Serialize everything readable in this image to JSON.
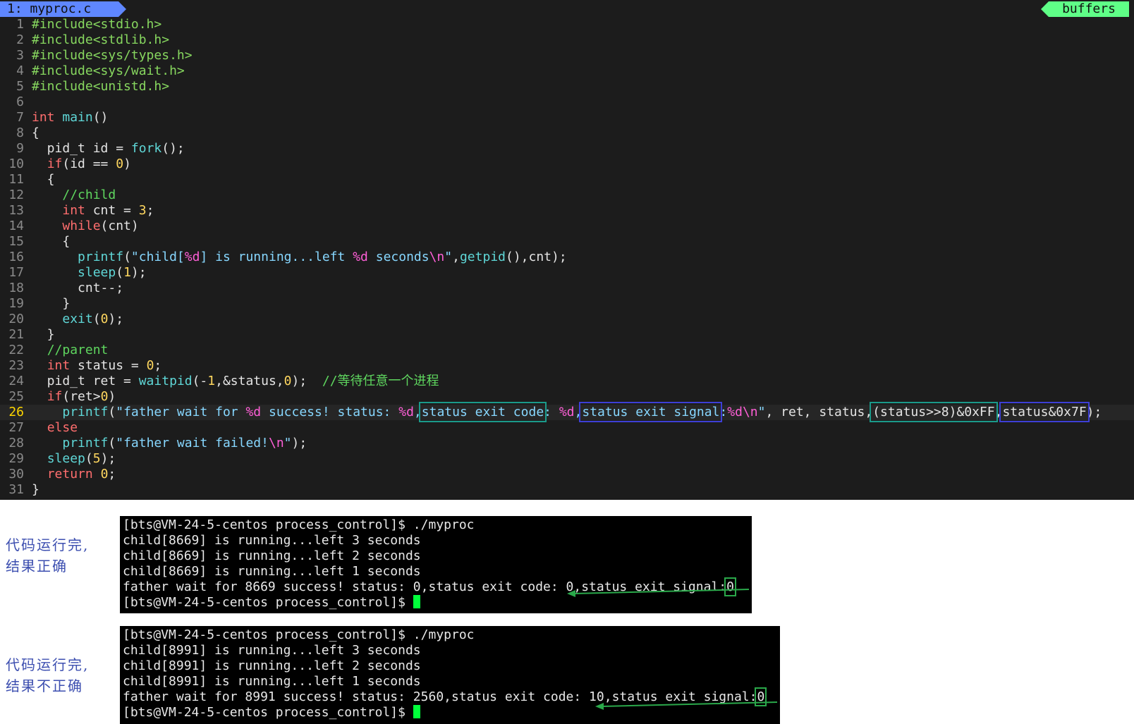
{
  "tabline": {
    "active_tab": "1: myproc.c",
    "buffers_label": "buffers"
  },
  "editor": {
    "current_line": 26,
    "lines": [
      {
        "n": "1",
        "t": [
          [
            "pp",
            "#include<stdio.h>"
          ]
        ]
      },
      {
        "n": "2",
        "t": [
          [
            "pp",
            "#include<stdlib.h>"
          ]
        ]
      },
      {
        "n": "3",
        "t": [
          [
            "pp",
            "#include<sys/types.h>"
          ]
        ]
      },
      {
        "n": "4",
        "t": [
          [
            "pp",
            "#include<sys/wait.h>"
          ]
        ]
      },
      {
        "n": "5",
        "t": [
          [
            "pp",
            "#include<unistd.h>"
          ]
        ]
      },
      {
        "n": "6",
        "t": []
      },
      {
        "n": "7",
        "t": [
          [
            "kw",
            "int"
          ],
          [
            "op",
            " "
          ],
          [
            "fn",
            "main"
          ],
          [
            "op",
            "()"
          ]
        ]
      },
      {
        "n": "8",
        "t": [
          [
            "op",
            "{"
          ]
        ]
      },
      {
        "n": "9",
        "t": [
          [
            "op",
            "  pid_t id = "
          ],
          [
            "fn",
            "fork"
          ],
          [
            "op",
            "();"
          ]
        ]
      },
      {
        "n": "10",
        "t": [
          [
            "op",
            "  "
          ],
          [
            "kw",
            "if"
          ],
          [
            "op",
            "(id == "
          ],
          [
            "num",
            "0"
          ],
          [
            "op",
            ")"
          ]
        ]
      },
      {
        "n": "11",
        "t": [
          [
            "op",
            "  {"
          ]
        ]
      },
      {
        "n": "12",
        "t": [
          [
            "op",
            "    "
          ],
          [
            "cm",
            "//child"
          ]
        ]
      },
      {
        "n": "13",
        "t": [
          [
            "op",
            "    "
          ],
          [
            "kw",
            "int"
          ],
          [
            "op",
            " cnt = "
          ],
          [
            "num",
            "3"
          ],
          [
            "op",
            ";"
          ]
        ]
      },
      {
        "n": "14",
        "t": [
          [
            "op",
            "    "
          ],
          [
            "kw",
            "while"
          ],
          [
            "op",
            "(cnt)"
          ]
        ]
      },
      {
        "n": "15",
        "t": [
          [
            "op",
            "    {"
          ]
        ]
      },
      {
        "n": "16",
        "t": [
          [
            "op",
            "      "
          ],
          [
            "fn",
            "printf"
          ],
          [
            "op",
            "("
          ],
          [
            "st",
            "\"child["
          ],
          [
            "fmt",
            "%d"
          ],
          [
            "st",
            "] is running...left "
          ],
          [
            "fmt",
            "%d"
          ],
          [
            "st",
            " seconds"
          ],
          [
            "fmt",
            "\\n"
          ],
          [
            "st",
            "\""
          ],
          [
            "op",
            ","
          ],
          [
            "fn",
            "getpid"
          ],
          [
            "op",
            "(),cnt);"
          ]
        ]
      },
      {
        "n": "17",
        "t": [
          [
            "op",
            "      "
          ],
          [
            "fn",
            "sleep"
          ],
          [
            "op",
            "("
          ],
          [
            "num",
            "1"
          ],
          [
            "op",
            ");"
          ]
        ]
      },
      {
        "n": "18",
        "t": [
          [
            "op",
            "      cnt--;"
          ]
        ]
      },
      {
        "n": "19",
        "t": [
          [
            "op",
            "    }"
          ]
        ]
      },
      {
        "n": "20",
        "t": [
          [
            "op",
            "    "
          ],
          [
            "fn",
            "exit"
          ],
          [
            "op",
            "("
          ],
          [
            "num",
            "0"
          ],
          [
            "op",
            ");"
          ]
        ]
      },
      {
        "n": "21",
        "t": [
          [
            "op",
            "  }"
          ]
        ]
      },
      {
        "n": "22",
        "t": [
          [
            "op",
            "  "
          ],
          [
            "cm",
            "//parent"
          ]
        ]
      },
      {
        "n": "23",
        "t": [
          [
            "op",
            "  "
          ],
          [
            "kw",
            "int"
          ],
          [
            "op",
            " status = "
          ],
          [
            "num",
            "0"
          ],
          [
            "op",
            ";"
          ]
        ]
      },
      {
        "n": "24",
        "t": [
          [
            "op",
            "  pid_t ret = "
          ],
          [
            "fn",
            "waitpid"
          ],
          [
            "op",
            "(-"
          ],
          [
            "num",
            "1"
          ],
          [
            "op",
            ",&status,"
          ],
          [
            "num",
            "0"
          ],
          [
            "op",
            ");  "
          ],
          [
            "cm",
            "//等待任意一个进程"
          ]
        ]
      },
      {
        "n": "25",
        "t": [
          [
            "op",
            "  "
          ],
          [
            "kw",
            "if"
          ],
          [
            "op",
            "(ret>"
          ],
          [
            "num",
            "0"
          ],
          [
            "op",
            ")"
          ]
        ]
      },
      {
        "n": "26",
        "t": [
          [
            "op",
            "    "
          ],
          [
            "fn",
            "printf"
          ],
          [
            "op",
            "("
          ],
          [
            "st",
            "\"father wait for "
          ],
          [
            "fmt",
            "%d"
          ],
          [
            "st",
            " success! status: "
          ],
          [
            "fmt",
            "%d"
          ],
          [
            "st",
            ","
          ],
          [
            "st box-teal",
            "status exit code"
          ],
          [
            "st",
            ": "
          ],
          [
            "fmt",
            "%d"
          ],
          [
            "st",
            ","
          ],
          [
            "st box-blue",
            "status exit signal"
          ],
          [
            "st",
            ":"
          ],
          [
            "fmt",
            "%d\\n"
          ],
          [
            "st",
            "\""
          ],
          [
            "op",
            ", ret, status,"
          ],
          [
            "op box-teal",
            "(status>>8)&0xFF"
          ],
          [
            "op",
            ","
          ],
          [
            "op box-blue",
            "status&0x7F"
          ],
          [
            "op",
            ");"
          ]
        ]
      },
      {
        "n": "27",
        "t": [
          [
            "op",
            "  "
          ],
          [
            "kw",
            "else"
          ]
        ]
      },
      {
        "n": "28",
        "t": [
          [
            "op",
            "    "
          ],
          [
            "fn",
            "printf"
          ],
          [
            "op",
            "("
          ],
          [
            "st",
            "\"father wait failed!"
          ],
          [
            "fmt",
            "\\n"
          ],
          [
            "st",
            "\""
          ],
          [
            "op",
            ");"
          ]
        ]
      },
      {
        "n": "29",
        "t": [
          [
            "op",
            "  "
          ],
          [
            "fn",
            "sleep"
          ],
          [
            "op",
            "("
          ],
          [
            "num",
            "5"
          ],
          [
            "op",
            ");"
          ]
        ]
      },
      {
        "n": "30",
        "t": [
          [
            "op",
            "  "
          ],
          [
            "kw",
            "return"
          ],
          [
            "op",
            " "
          ],
          [
            "num",
            "0"
          ],
          [
            "op",
            ";"
          ]
        ]
      },
      {
        "n": "31",
        "t": [
          [
            "op",
            "}"
          ]
        ]
      }
    ]
  },
  "terminal1": {
    "lines": [
      "[bts@VM-24-5-centos process_control]$ ./myproc",
      "child[8669] is running...left 3 seconds",
      "child[8669] is running...left 2 seconds",
      "child[8669] is running...left 1 seconds"
    ],
    "result_prefix": "father wait for 8669 success! status: 0,status exit code: 0,status exit signal:",
    "result_signal": "0",
    "prompt": "[bts@VM-24-5-centos process_control]$ "
  },
  "terminal2": {
    "lines": [
      "[bts@VM-24-5-centos process_control]$ ./myproc",
      "child[8991] is running...left 3 seconds",
      "child[8991] is running...left 2 seconds",
      "child[8991] is running...left 1 seconds"
    ],
    "result_prefix": "father wait for 8991 success! status: 2560,status exit code: 10,status exit signal:",
    "result_signal": "0",
    "prompt": "[bts@VM-24-5-centos process_control]$ "
  },
  "annotations": {
    "note1_line1": "代码运行完,",
    "note1_line2": "结果正确",
    "note2_line1": "代码运行完,",
    "note2_line2": "结果不正确"
  },
  "colors": {
    "editor_bg": "#1c1c1c",
    "tab_active": "#5f87ff",
    "buffers_tag": "#5fff87",
    "highlight_teal": "#1a9a8a",
    "highlight_blue": "#3d3fd6",
    "cursor": "#00ff3a",
    "annotation": "#3d4fb0"
  }
}
